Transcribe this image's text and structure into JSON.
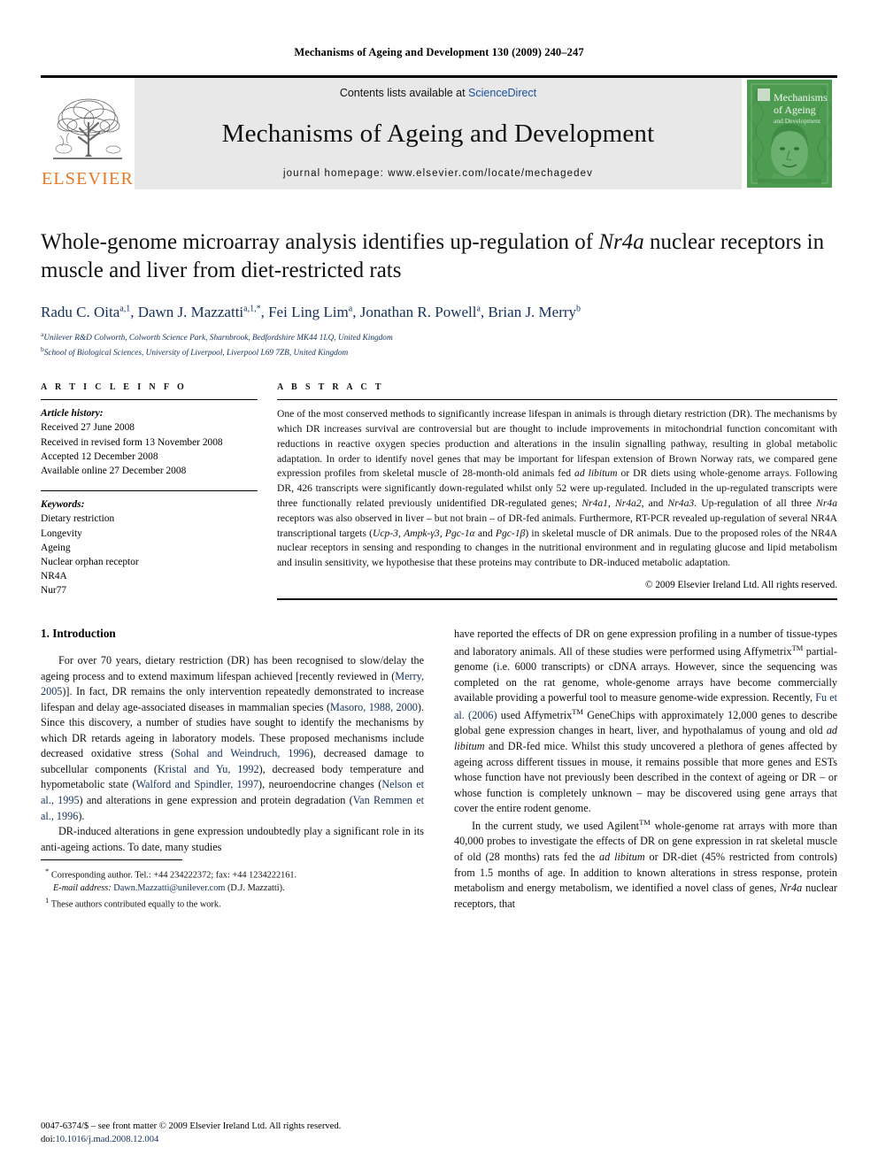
{
  "running_head": "Mechanisms of Ageing and Development 130 (2009) 240–247",
  "banner": {
    "contents_prefix": "Contents lists available at ",
    "sciencedirect": "ScienceDirect",
    "journal_name": "Mechanisms of Ageing and Development",
    "homepage": "journal homepage: www.elsevier.com/locate/mechagedev",
    "publisher_wordmark": "ELSEVIER",
    "publisher_color": "#E87722",
    "cover_title_line1": "Mechanisms",
    "cover_title_line2": "of Ageing",
    "cover_title_line3": "and Development",
    "cover_color": "#4e9c52"
  },
  "title": {
    "line1_a": "Whole-genome microarray analysis identifies up-regulation of ",
    "line1_italic": "Nr4a",
    "line1_b": " nuclear",
    "line2": "receptors in muscle and liver from diet-restricted rats"
  },
  "authors": {
    "list": "Radu C. Oita a,1, Dawn J. Mazzatti a,1,*, Fei Ling Lim a, Jonathan R. Powell a, Brian J. Merry b",
    "a1": "Radu C. Oita",
    "a1sup": "a,1",
    "a2": ", Dawn J. Mazzatti",
    "a2sup": "a,1,*",
    "a3": ", Fei Ling Lim",
    "a3sup": "a",
    "a4": ", Jonathan R. Powell",
    "a4sup": "a",
    "a5": ", Brian J. Merry",
    "a5sup": "b",
    "affil_a_sup": "a",
    "affil_a": "Unilever R&D Colworth, Colworth Science Park, Sharnbrook, Bedfordshire MK44 1LQ, United Kingdom",
    "affil_b_sup": "b",
    "affil_b": "School of Biological Sciences, University of Liverpool, Liverpool L69 7ZB, United Kingdom"
  },
  "article_info": {
    "label": "A R T I C L E   I N F O",
    "history_label": "Article history:",
    "history": [
      "Received 27 June 2008",
      "Received in revised form 13 November 2008",
      "Accepted 12 December 2008",
      "Available online 27 December 2008"
    ],
    "keywords_label": "Keywords:",
    "keywords": [
      "Dietary restriction",
      "Longevity",
      "Ageing",
      "Nuclear orphan receptor",
      "NR4A",
      "Nur77"
    ]
  },
  "abstract": {
    "label": "A B S T R A C T",
    "p1": "One of the most conserved methods to significantly increase lifespan in animals is through dietary restriction (DR). The mechanisms by which DR increases survival are controversial but are thought to include improvements in mitochondrial function concomitant with reductions in reactive oxygen species production and alterations in the insulin signalling pathway, resulting in global metabolic adaptation. In order to identify novel genes that may be important for lifespan extension of Brown Norway rats, we compared gene expression profiles from skeletal muscle of 28-month-old animals fed ",
    "i1": "ad libitum",
    "p2": " or DR diets using whole-genome arrays. Following DR, 426 transcripts were significantly down-regulated whilst only 52 were up-regulated. Included in the up-regulated transcripts were three functionally related previously unidentified DR-regulated genes; ",
    "i2": "Nr4a1",
    "p3": ", ",
    "i3": "Nr4a2",
    "p4": ", and ",
    "i4": "Nr4a3",
    "p5": ". Up-regulation of all three ",
    "i5": "Nr4a",
    "p6": " receptors was also observed in liver – but not brain – of DR-fed animals. Furthermore, RT-PCR revealed up-regulation of several NR4A transcriptional targets (",
    "i6": "Ucp-3",
    "p7": ", ",
    "i7": "Ampk-γ3",
    "p8": ", ",
    "i8": "Pgc-1α",
    "p9": " and ",
    "i9": "Pgc-1β",
    "p10": ") in skeletal muscle of DR animals. Due to the proposed roles of the NR4A nuclear receptors in sensing and responding to changes in the nutritional environment and in regulating glucose and lipid metabolism and insulin sensitivity, we hypothesise that these proteins may contribute to DR-induced metabolic adaptation.",
    "copyright": "© 2009 Elsevier Ireland Ltd. All rights reserved."
  },
  "intro": {
    "heading": "1. Introduction",
    "left_p1_a": "For over 70 years, dietary restriction (DR) has been recognised to slow/delay the ageing process and to extend maximum lifespan achieved [recently reviewed in (",
    "left_cite1": "Merry, 2005",
    "left_p1_b": ")]. In fact, DR remains the only intervention repeatedly demonstrated to increase lifespan and delay age-associated diseases in mammalian species (",
    "left_cite2": "Masoro, 1988, 2000",
    "left_p1_c": "). Since this discovery, a number of studies have sought to identify the mechanisms by which DR retards ageing in laboratory models. These proposed mechanisms include decreased oxidative stress (",
    "left_cite3": "Sohal and Weindruch, 1996",
    "left_p1_d": "), decreased damage to subcellular components (",
    "left_cite4": "Kristal and Yu, 1992",
    "left_p1_e": "), decreased body temperature and hypometabolic state (",
    "left_cite5": "Walford and Spindler, 1997",
    "left_p1_f": "), neuroendocrine changes (",
    "left_cite6": "Nelson et al., 1995",
    "left_p1_g": ") and alterations in gene expression and protein degradation (",
    "left_cite7": "Van Remmen et al., 1996",
    "left_p1_h": ").",
    "left_p2": "DR-induced alterations in gene expression undoubtedly play a significant role in its anti-ageing actions. To date, many studies",
    "right_p1_a": "have reported the effects of DR on gene expression profiling in a number of tissue-types and laboratory animals. All of these studies were performed using Affymetrix",
    "tm": "TM",
    "right_p1_b": " partial-genome (i.e. 6000 transcripts) or cDNA arrays. However, since the sequencing was completed on the rat genome, whole-genome arrays have become commercially available providing a powerful tool to measure genome-wide expression. Recently, ",
    "right_cite1": "Fu et al. (2006)",
    "right_p1_c": " used Affymetrix",
    "right_p1_d": " GeneChips with approximately 12,000 genes to describe global gene expression changes in heart, liver, and hypothalamus of young and old ",
    "right_i1": "ad libitum",
    "right_p1_e": " and DR-fed mice. Whilst this study uncovered a plethora of genes affected by ageing across different tissues in mouse, it remains possible that more genes and ESTs whose function have not previously been described in the context of ageing or DR – or whose function is completely unknown – may be discovered using gene arrays that cover the entire rodent genome.",
    "right_p2_a": "In the current study, we used Agilent",
    "right_p2_b": " whole-genome rat arrays with more than 40,000 probes to investigate the effects of DR on gene expression in rat skeletal muscle of old (28 months) rats fed the ",
    "right_i2": "ad libitum",
    "right_p2_c": " or DR-diet (45% restricted from controls) from 1.5 months of age. In addition to known alterations in stress response, protein metabolism and energy metabolism, we identified a novel class of genes, ",
    "right_i3": "Nr4a",
    "right_p2_d": " nuclear receptors, that"
  },
  "footnotes": {
    "star_marker": "*",
    "star_text": "Corresponding author. Tel.: +44 234222372; fax: +44 1234222161.",
    "email_label": "E-mail address:",
    "email": "Dawn.Mazzatti@unilever.com",
    "email_suffix": "(D.J. Mazzatti).",
    "one_marker": "1",
    "one_text": "These authors contributed equally to the work."
  },
  "page_footer": {
    "issn_line": "0047-6374/$ – see front matter © 2009 Elsevier Ireland Ltd. All rights reserved.",
    "doi_prefix": "doi:",
    "doi": "10.1016/j.mad.2008.12.004"
  }
}
